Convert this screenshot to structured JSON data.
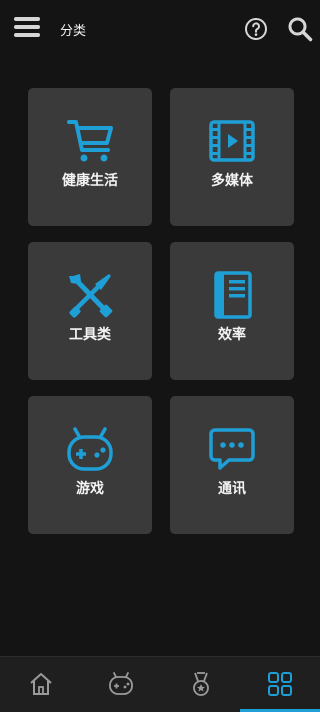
{
  "header": {
    "title": "分类"
  },
  "colors": {
    "accent": "#1e9fd6",
    "tile": "#3a3a3a",
    "background": "#141414"
  },
  "categories": [
    {
      "label": "健康生活",
      "icon": "shopping-cart-icon"
    },
    {
      "label": "多媒体",
      "icon": "film-video-icon"
    },
    {
      "label": "工具类",
      "icon": "tools-icon"
    },
    {
      "label": "效率",
      "icon": "notebook-icon"
    },
    {
      "label": "游戏",
      "icon": "gamepad-icon"
    },
    {
      "label": "通讯",
      "icon": "chat-bubble-icon"
    }
  ],
  "bottom_nav": [
    {
      "icon": "home-icon",
      "active": false
    },
    {
      "icon": "gamepad-icon",
      "active": false
    },
    {
      "icon": "medal-icon",
      "active": false
    },
    {
      "icon": "grid-icon",
      "active": true
    }
  ]
}
